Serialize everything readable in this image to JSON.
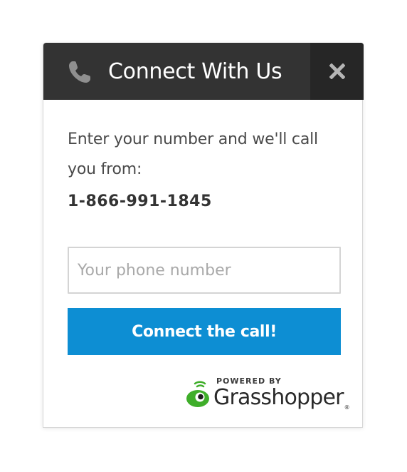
{
  "header": {
    "title": "Connect With Us",
    "icon": "phone-icon",
    "close_icon": "close-icon",
    "background_color": "#333333",
    "close_background_color": "#262626"
  },
  "body": {
    "intro_text": "Enter your number and we'll call you from:",
    "phone_number": "1-866-991-1845"
  },
  "form": {
    "phone_input": {
      "placeholder": "Your phone number",
      "value": ""
    },
    "submit_label": "Connect the call!",
    "submit_color": "#0d8ed3"
  },
  "footer": {
    "powered_by": "POWERED BY",
    "brand": "Grasshopper",
    "trademark": "®",
    "brand_color": "#3fae2a"
  }
}
